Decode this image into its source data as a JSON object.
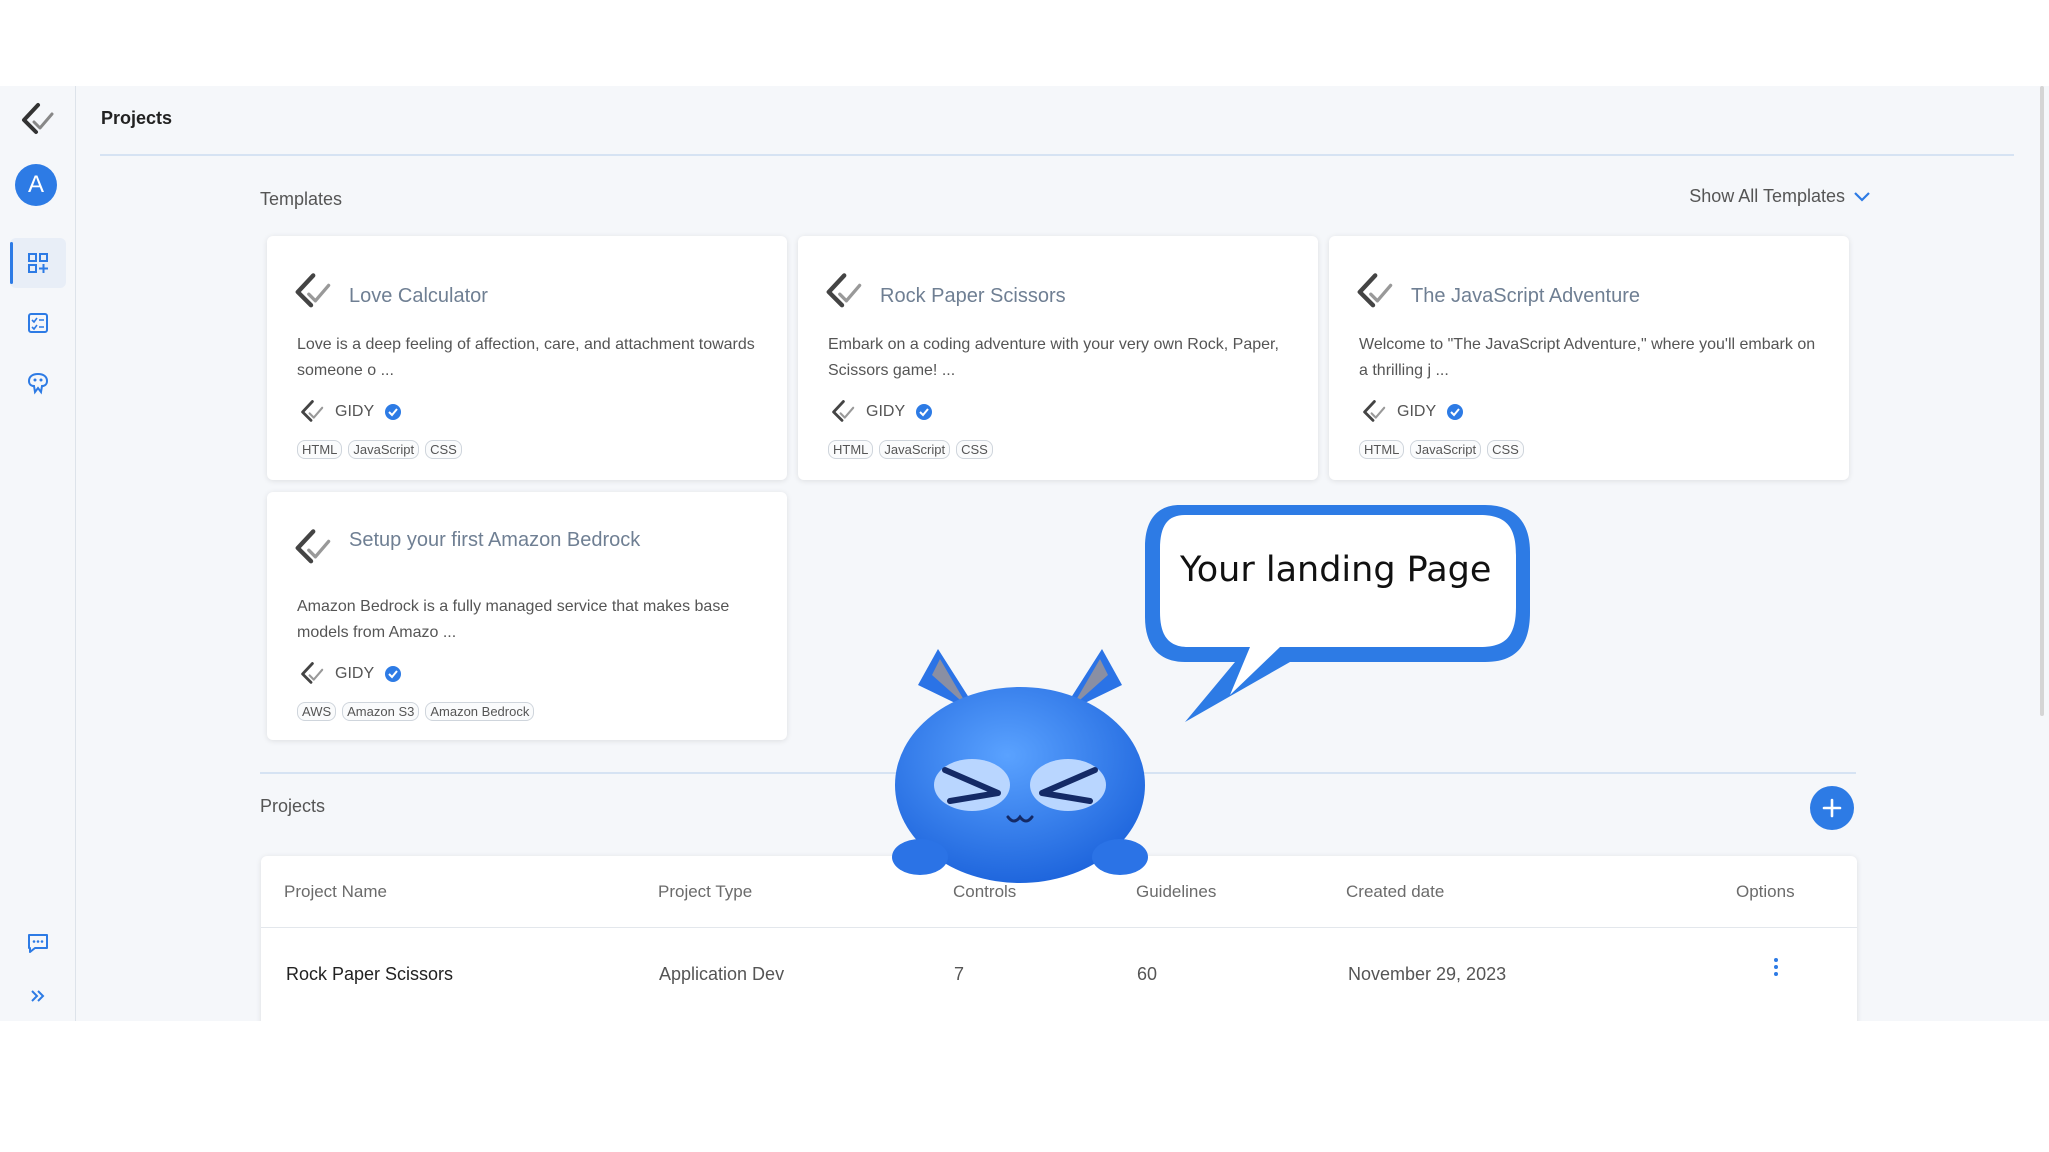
{
  "header": {
    "title": "Projects"
  },
  "sidebar": {
    "avatar_letter": "A"
  },
  "templates": {
    "label": "Templates",
    "show_all_label": "Show All Templates",
    "cards": [
      {
        "title": "Love Calculator",
        "description": "Love is a deep feeling of affection, care, and attachment towards someone o ...",
        "owner": "GIDY",
        "tags": [
          "HTML",
          "JavaScript",
          "CSS"
        ]
      },
      {
        "title": "Rock Paper Scissors",
        "description": "Embark on a coding adventure with your very own Rock, Paper, Scissors game! ...",
        "owner": "GIDY",
        "tags": [
          "HTML",
          "JavaScript",
          "CSS"
        ]
      },
      {
        "title": "The JavaScript Adventure",
        "description": "Welcome to \"The JavaScript Adventure,\" where you'll embark on a thrilling j ...",
        "owner": "GIDY",
        "tags": [
          "HTML",
          "JavaScript",
          "CSS"
        ]
      },
      {
        "title": "Setup your first Amazon Bedrock",
        "description": "Amazon Bedrock is a fully managed service that makes base models from Amazo ...",
        "owner": "GIDY",
        "tags": [
          "AWS",
          "Amazon S3",
          "Amazon Bedrock"
        ]
      }
    ]
  },
  "projects": {
    "label": "Projects",
    "columns": [
      "Project Name",
      "Project Type",
      "Controls",
      "Guidelines",
      "Created date",
      "Options"
    ],
    "rows": [
      {
        "name": "Rock Paper Scissors",
        "type": "Application Dev",
        "controls": "7",
        "guidelines": "60",
        "created": "November 29, 2023"
      }
    ]
  },
  "overlay": {
    "bubble_text": "Your landing Page"
  },
  "colors": {
    "accent": "#2d7be5",
    "background": "#f5f7fa",
    "card_title": "#6f7f93"
  },
  "icons": [
    "gidy-logo-icon",
    "templates-icon",
    "task-list-icon",
    "brain-icon",
    "chat-icon",
    "expand-icon",
    "chevron-down-icon",
    "verified-icon",
    "plus-icon",
    "kebab-menu-icon"
  ]
}
